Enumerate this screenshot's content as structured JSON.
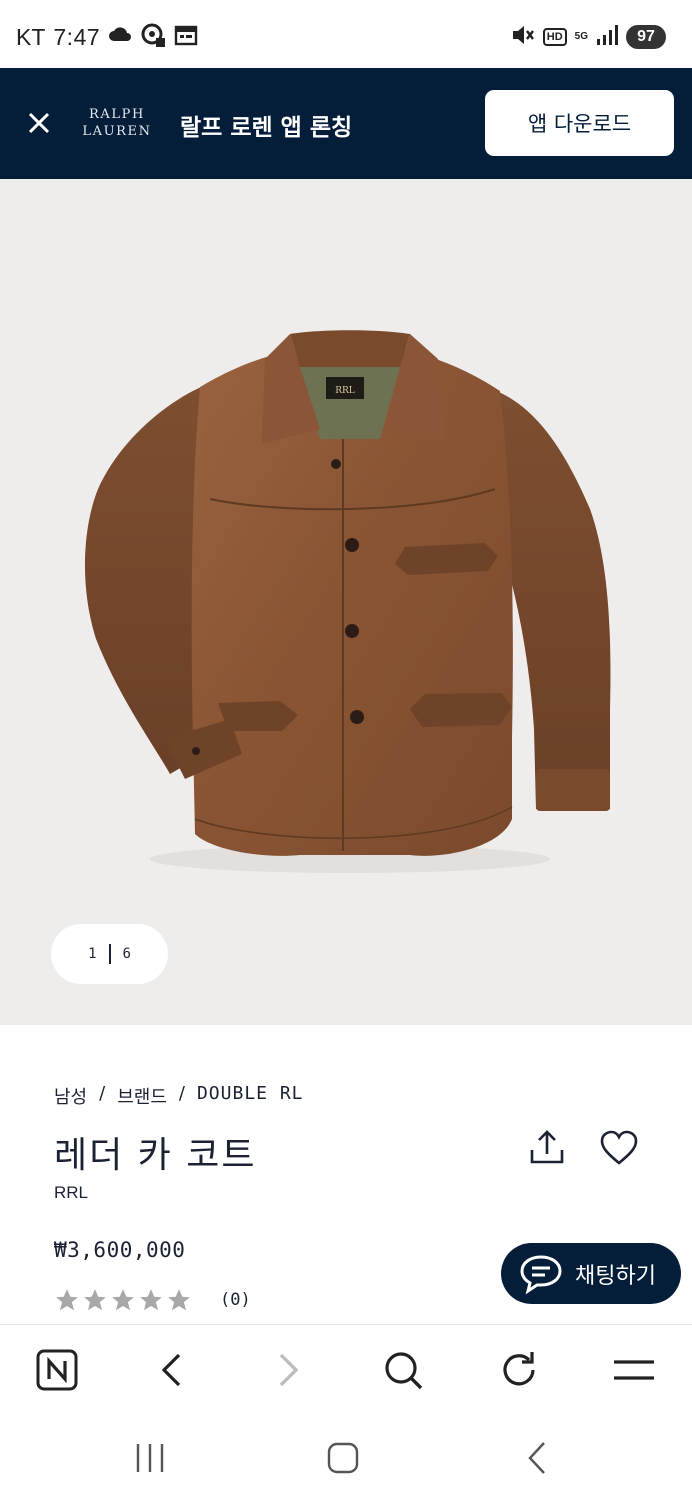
{
  "status_bar": {
    "carrier": "KT",
    "time": "7:47",
    "hd_label": "HD",
    "network_label": "5G",
    "battery": "97"
  },
  "app_banner": {
    "logo_line1": "RALPH",
    "logo_line2": "LAUREN",
    "title": "랄프 로렌 앱 론칭",
    "download_label": "앱 다운로드",
    "background_color": "#041e3a"
  },
  "gallery": {
    "current_image": "1",
    "total_images": "6"
  },
  "product": {
    "breadcrumb": [
      "남성",
      "브랜드",
      "DOUBLE RL"
    ],
    "breadcrumb_separator": "/",
    "title": "레더 카 코트",
    "brand": "RRL",
    "price": "₩3,600,000",
    "rating_stars": 0,
    "review_count": "(0)"
  },
  "chat": {
    "label": "채팅하기"
  },
  "browser_bar": {
    "icons": [
      "naver-home-icon",
      "back-icon",
      "forward-icon",
      "search-icon",
      "refresh-icon",
      "menu-icon"
    ]
  },
  "android_nav": {
    "icons": [
      "recent-apps-icon",
      "home-icon",
      "back-icon"
    ]
  }
}
